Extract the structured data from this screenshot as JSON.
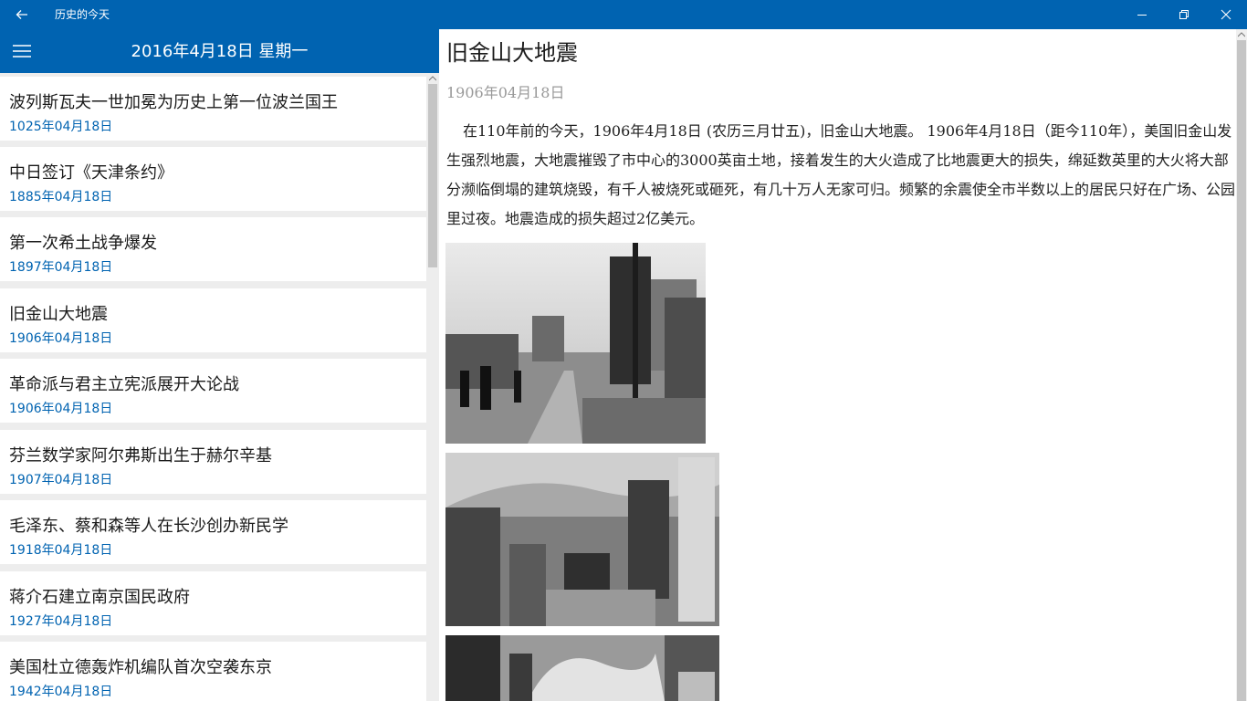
{
  "window": {
    "title": "历史的今天",
    "back_icon": "back-arrow-icon",
    "minimize_icon": "minimize-icon",
    "maximize_icon": "restore-icon",
    "close_icon": "close-icon"
  },
  "header": {
    "menu_icon": "hamburger-menu-icon",
    "date": "2016年4月18日 星期一",
    "accent_color": "#0063b1"
  },
  "events": [
    {
      "title": "波列斯瓦夫一世加冕为历史上第一位波兰国王",
      "date": "1025年04月18日"
    },
    {
      "title": "中日签订《天津条约》",
      "date": "1885年04月18日"
    },
    {
      "title": "第一次希土战争爆发",
      "date": "1897年04月18日"
    },
    {
      "title": "旧金山大地震",
      "date": "1906年04月18日"
    },
    {
      "title": "革命派与君主立宪派展开大论战",
      "date": "1906年04月18日"
    },
    {
      "title": "芬兰数学家阿尔弗斯出生于赫尔辛基",
      "date": "1907年04月18日"
    },
    {
      "title": "毛泽东、蔡和森等人在长沙创办新民学",
      "date": "1918年04月18日"
    },
    {
      "title": "蒋介石建立南京国民政府",
      "date": "1927年04月18日"
    },
    {
      "title": "美国杜立德轰炸机编队首次空袭东京",
      "date": "1942年04月18日"
    }
  ],
  "detail": {
    "title": "旧金山大地震",
    "date": "1906年04月18日",
    "body": "在110年前的今天，1906年4月18日 (农历三月廿五)，旧金山大地震。  1906年4月18日（距今110年），美国旧金山发生强烈地震，大地震摧毁了市中心的3000英亩土地，接着发生的大火造成了比地震更大的损失，绵延数英里的大火将大部分濒临倒塌的建筑烧毁，有千人被烧死或砸死，有几十万人无家可归。频繁的余震使全市半数以上的居民只好在广场、公园里过夜。地震造成的损失超过2亿美元。"
  }
}
